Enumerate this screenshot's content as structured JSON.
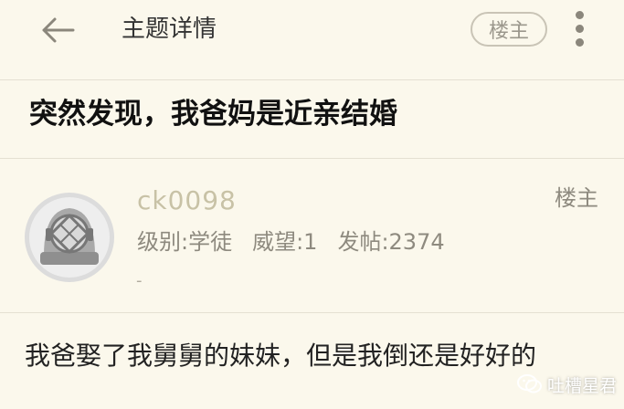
{
  "header": {
    "title": "主题详情",
    "owner_button": "楼主",
    "back_icon": "arrow-left-icon",
    "more_icon": "more-vertical-icon"
  },
  "thread": {
    "title": "突然发现，我爸妈是近亲结婚"
  },
  "post": {
    "username": "ck0098",
    "floor_tag": "楼主",
    "level": "级别:学徒",
    "prestige": "威望:1",
    "posts": "发帖:2374",
    "signature": "-",
    "content": "我爸娶了我舅舅的妹妹，但是我倒还是好好的",
    "avatar_icon": "diving-helmet-avatar"
  },
  "watermark": {
    "text": "吐槽星君",
    "icon": "wechat-icon"
  },
  "colors": {
    "background": "#fbf8ec",
    "divider": "#e4e0d2",
    "username": "#c8c2a6",
    "meta": "#8e8a7f"
  }
}
